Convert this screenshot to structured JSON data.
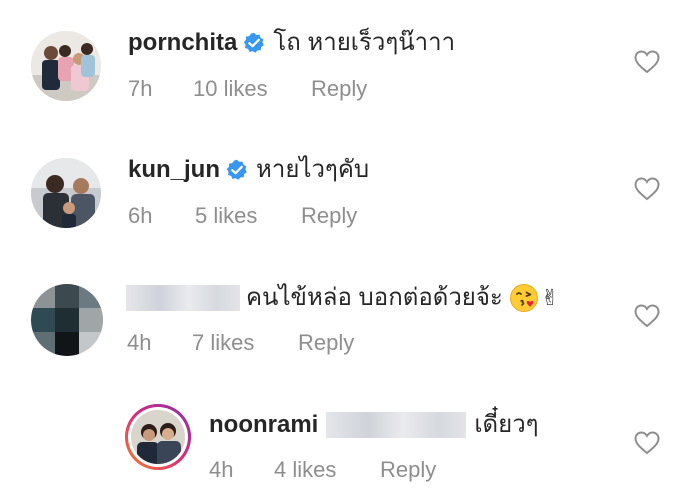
{
  "comments": [
    {
      "username": "pornchita",
      "verified": true,
      "text": "โถ หายเร็วๆน๊าาา",
      "time": "7h",
      "likes": "10 likes",
      "reply": "Reply"
    },
    {
      "username": "kun_jun",
      "verified": true,
      "text": "หายไวๆคับ",
      "time": "6h",
      "likes": "5 likes",
      "reply": "Reply"
    },
    {
      "username": "",
      "verified": false,
      "text": "คนไข้หล่อ บอกต่อด้วยจ้ะ",
      "emoji": "face-blowing-kiss-icon",
      "extra_emoji": "✌",
      "time": "4h",
      "likes": "7 likes",
      "reply": "Reply"
    },
    {
      "username": "noonrami",
      "verified": false,
      "text": "เดี๋ยวๆ",
      "time": "4h",
      "likes": "4 likes",
      "reply": "Reply"
    }
  ],
  "colors": {
    "verified_badge": "#3897f0",
    "meta_text": "#8e8e8e",
    "primary_text": "#262626",
    "story_ring_start": "#f58529",
    "story_ring_end": "#dd2a7b"
  }
}
